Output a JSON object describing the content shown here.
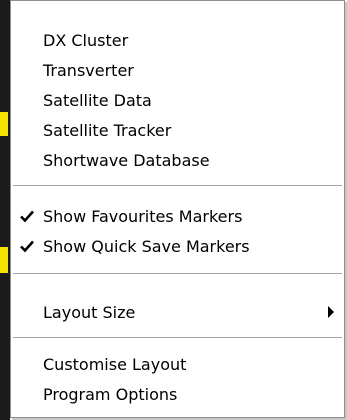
{
  "menu": {
    "items": [
      {
        "label": "DX Cluster"
      },
      {
        "label": "Transverter"
      },
      {
        "label": "Satellite Data"
      },
      {
        "label": "Satellite Tracker"
      },
      {
        "label": "Shortwave Database"
      },
      {
        "label": "Show Favourites Markers",
        "checked": true
      },
      {
        "label": "Show Quick Save Markers",
        "checked": true
      },
      {
        "label": "Layout Size",
        "has_submenu": true
      },
      {
        "label": "Customise Layout"
      },
      {
        "label": "Program Options"
      }
    ]
  },
  "colors": {
    "menu_background": "#ffffff",
    "menu_border": "#8d8d8d",
    "text": "#000000",
    "background_strip": "#1b1b1b",
    "background_accent": "#f2e300"
  }
}
